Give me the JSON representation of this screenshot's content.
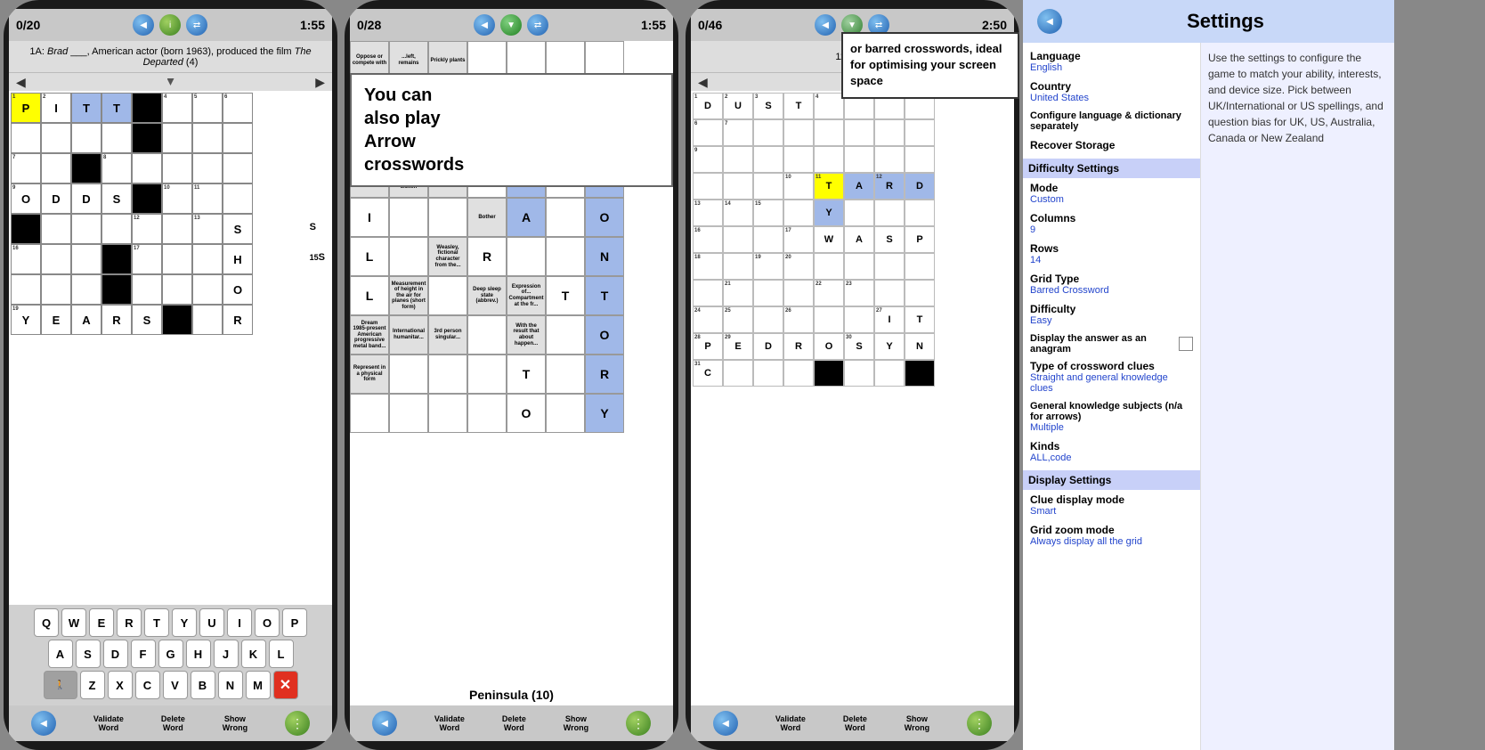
{
  "phones": [
    {
      "id": "phone1",
      "score": "0/20",
      "timer": "1:55",
      "clue": "1A: Brad ___, American actor (born 1963), produced the film The Departed (4)",
      "grid_cols": 8,
      "grid_rows": 8,
      "cell_size": 38,
      "keyboard": true,
      "bottom_buttons": [
        "Validate\nWord",
        "Delete\nWord",
        "Show\nWrong"
      ]
    },
    {
      "id": "phone2",
      "score": "0/28",
      "timer": "1:55",
      "clue": "",
      "promo": "You can also play Arrow crosswords",
      "bottom_buttons": [
        "Validate\nWord",
        "Delete\nWord",
        "Show\nWrong"
      ],
      "peninsula_label": "Peninsula (10)"
    },
    {
      "id": "phone3",
      "score": "0/46",
      "timer": "2:50",
      "clue": "11A: Be",
      "popup_clue": "or barred crosswords, ideal for optimising your screen space",
      "bottom_buttons": [
        "Validate\nWord",
        "Delete\nWord",
        "Show\nWrong"
      ]
    }
  ],
  "settings": {
    "title": "Settings",
    "description": "Use the settings to configure the game to match your ability, interests, and device size. Pick between UK/International or US spellings, and question bias for UK, US, Australia, Canada or New Zealand",
    "language_label": "Language",
    "language_value": "English",
    "country_label": "Country",
    "country_value": "United States",
    "configure_label": "Configure language & dictionary separately",
    "recover_label": "Recover Storage",
    "difficulty_header": "Difficulty Settings",
    "mode_label": "Mode",
    "mode_value": "Custom",
    "columns_label": "Columns",
    "columns_value": "9",
    "rows_label": "Rows",
    "rows_value": "14",
    "grid_type_label": "Grid Type",
    "grid_type_value": "Barred Crossword",
    "difficulty_label": "Difficulty",
    "difficulty_value": "Easy",
    "anagram_label": "Display the answer as an anagram",
    "clue_type_label": "Type of crossword clues",
    "clue_type_value": "Straight and general knowledge clues",
    "gk_label": "General knowledge subjects (n/a for arrows)",
    "gk_value": "Multiple",
    "kinds_label": "Kinds",
    "kinds_value": "ALL,code",
    "display_header": "Display Settings",
    "clue_display_label": "Clue display mode",
    "clue_display_value": "Smart",
    "zoom_label": "Grid zoom mode",
    "zoom_value": "Always display all the grid"
  }
}
